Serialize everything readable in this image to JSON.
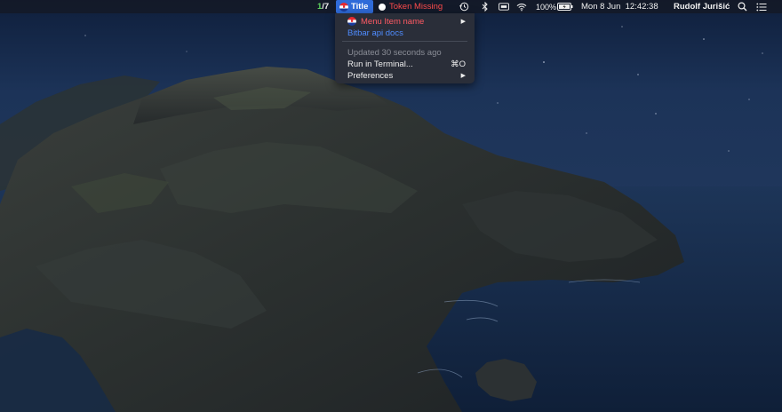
{
  "menubar": {
    "counter_current": "1",
    "counter_rest": "/7",
    "title_label": "Title",
    "token_label": "Token Missing",
    "battery_percent": "100%",
    "datetime": "Mon 8 Jun  12:42:38",
    "user_name": "Rudolf Jurišić"
  },
  "dropdown": {
    "items": [
      {
        "label": "Menu Item name",
        "color": "#ff5a63",
        "has_submenu": true,
        "icon": "croatia-flag-icon"
      },
      {
        "label": "Bitbar api docs",
        "color": "#4f8cff"
      },
      {
        "label": "Updated 30 seconds ago",
        "disabled": true
      },
      {
        "label": "Run in Terminal...",
        "shortcut": "⌘O"
      },
      {
        "label": "Preferences",
        "has_submenu": true
      }
    ],
    "submenu_arrow": "▶"
  },
  "colors": {
    "menubar_bg": "#141824",
    "title_highlight": "#2f6bd9",
    "token_missing": "#ff4c4c",
    "counter_green": "#5fd35f",
    "menu_bg": "#2a2e39"
  }
}
